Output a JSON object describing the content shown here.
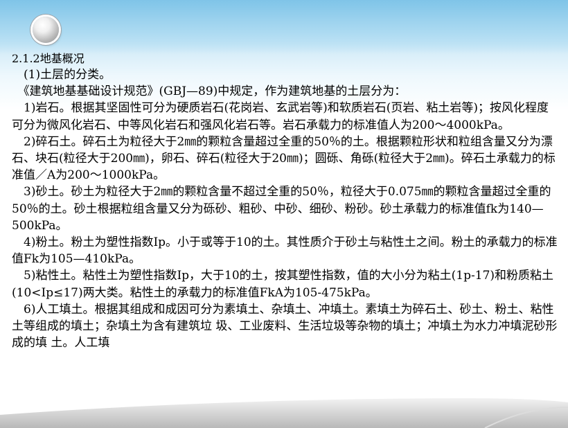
{
  "section_heading": "2.1.2地基概况",
  "paragraphs": [
    "　(1)土层的分类。",
    "　《建筑地基基础设计规范》(GBJ—89)中规定，作为建筑地基的土层分为：",
    "　1)岩石。根据其坚固性可分为硬质岩石(花岗岩、玄武岩等)和软质岩石(页岩、粘土岩等)；按风化程度可分为微风化岩石、中等风化岩石和强风化岩石等。岩石承载力的标准值人为200～4000kPa。",
    "　2)碎石土。碎石土为粒径大于2㎜的颗粒含量超过全重的50％的土。根据颗粒形状和粒组含量又分为漂石、块石(粒径大于200㎜)，卵石、碎石(粒径大于20㎜)；圆砾、角砾(粒径大于2㎜)。碎石土承载力的标准值／A为200～1000kPa。",
    "　3)砂土。砂土为粒径大于2㎜的颗粒含量不超过全重的50％，粒径大于0.075㎜的颗粒含量超过全重的50％的土。砂土根据粒组含量又分为砾砂、粗砂、中砂、细砂、粉砂。砂土承载力的标准值fk为140—500kPa。",
    "　4)粉土。粉土为塑性指数Ip。小于或等于10的土。其性质介于砂土与粘性土之间。粉土的承载力的标准值Fk为105—410kPa。",
    "　5)粘性土。粘性土为塑性指数Ip，大于10的土，按其塑性指数，值的大小分为粘土(1p-17)和粉质粘土(10<Ip≤17)两大类。粘性土的承载力的标准值FkA为105-475kPa。",
    "　6)人工填土。根据其组成和成因可分为素填土、杂填土、冲填土。素填土为碎石土、砂土、粉土、粘性土等组成的填土；杂填土为含有建筑垃 圾、工业废料、生活垃圾等杂物的填土；冲填土为水力冲填泥砂形成的填 土。人工填"
  ]
}
